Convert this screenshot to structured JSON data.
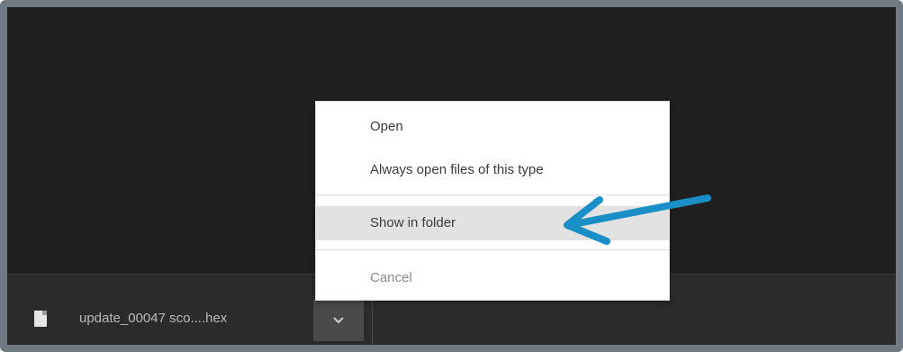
{
  "download": {
    "file_name": "update_00047 sco....hex"
  },
  "context_menu": {
    "items": [
      {
        "label": "Open"
      },
      {
        "label": "Always open files of this type"
      },
      {
        "label": "Show in folder"
      },
      {
        "label": "Cancel"
      }
    ]
  },
  "colors": {
    "arrow": "#1a8fc7",
    "background": "#1f1f1f",
    "download_bar": "#2b2b2b"
  },
  "icons": {
    "file": "file-icon",
    "chevron": "chevron-down-icon",
    "annotation": "arrow-left-icon"
  }
}
